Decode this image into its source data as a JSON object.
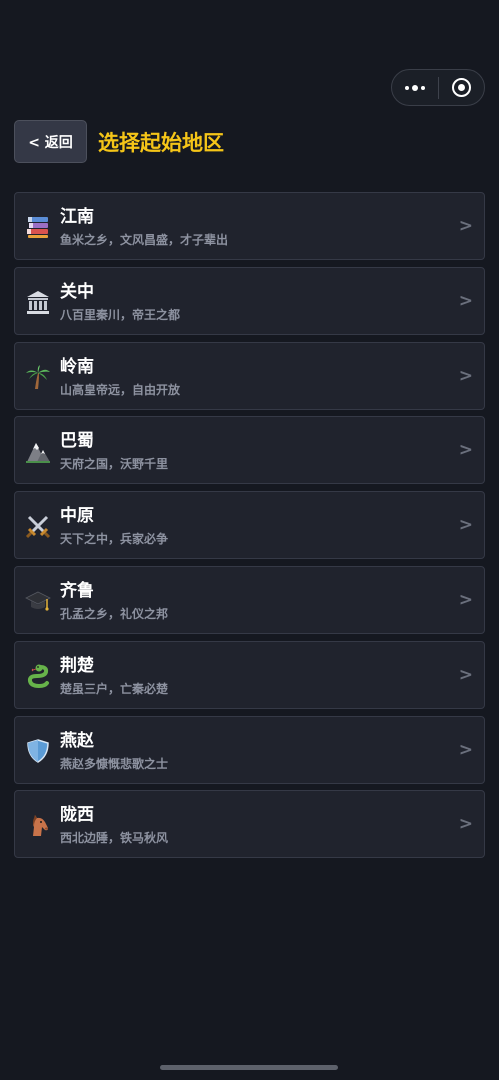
{
  "header": {
    "back_label": "< 返回",
    "title": "选择起始地区"
  },
  "capsule": {
    "menu_icon": "more-dots-icon",
    "close_icon": "target-circle-icon"
  },
  "regions": [
    {
      "name": "江南",
      "desc": "鱼米之乡，文风昌盛，才子辈出",
      "icon": "books-icon"
    },
    {
      "name": "关中",
      "desc": "八百里秦川，帝王之都",
      "icon": "classical-building-icon"
    },
    {
      "name": "岭南",
      "desc": "山高皇帝远，自由开放",
      "icon": "palm-tree-icon"
    },
    {
      "name": "巴蜀",
      "desc": "天府之国，沃野千里",
      "icon": "mountain-icon"
    },
    {
      "name": "中原",
      "desc": "天下之中，兵家必争",
      "icon": "crossed-swords-icon"
    },
    {
      "name": "齐鲁",
      "desc": "孔孟之乡，礼仪之邦",
      "icon": "graduation-cap-icon"
    },
    {
      "name": "荆楚",
      "desc": "楚虽三户，亡秦必楚",
      "icon": "snake-icon"
    },
    {
      "name": "燕赵",
      "desc": "燕赵多慷慨悲歌之士",
      "icon": "shield-icon"
    },
    {
      "name": "陇西",
      "desc": "西北边陲，铁马秋风",
      "icon": "horse-icon"
    }
  ],
  "chevron": ">",
  "colors": {
    "background": "#151820",
    "card": "#20232d",
    "accent_title": "#f5c518",
    "desc_text": "#8d92a0"
  }
}
